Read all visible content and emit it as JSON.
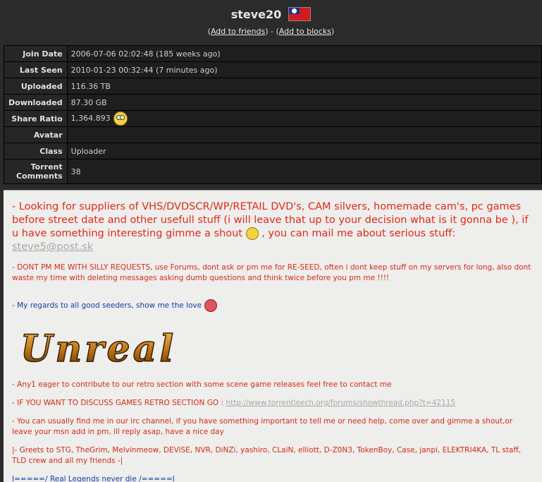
{
  "profile": {
    "username": "steve20",
    "add_friends": "Add to friends",
    "add_blocks": "Add to blocks"
  },
  "info_rows": [
    {
      "label": "Join Date",
      "value": "2006-07-06 02:02:48 (185 weeks ago)"
    },
    {
      "label": "Last Seen",
      "value": "2010-01-23 00:32:44 (7 minutes ago)"
    },
    {
      "label": "Uploaded",
      "value": "116.36 TB"
    },
    {
      "label": "Downloaded",
      "value": "87.30 GB"
    },
    {
      "label": "Share Ratio",
      "value": "1,364.893"
    },
    {
      "label": "Avatar",
      "value": ""
    },
    {
      "label": "Class",
      "value": "Uploader"
    },
    {
      "label": "Torrent Comments",
      "value": "38"
    }
  ],
  "description": {
    "big_text_a": "- Looking for suppliers of VHS/DVDSCR/WP/RETAIL DVD's, CAM silvers, homemade cam's, pc games before street date and other usefull stuff (i will leave that up to your decision what is it gonna be ), if u have something interesting gimme a shout",
    "big_text_b": ", you can mail me about serious stuff:",
    "email": "steve5@post.sk",
    "dont_pm": "- DONT PM ME WITH SILLY REQUESTS, use Forums, dont ask or pm me for RE-SEED, often i dont keep stuff on my servers for long, also dont waste my time with deleting messages asking dumb questions and think twice before you pm me !!!!",
    "regards": "- My regards to all good seeders, show me the love",
    "logo_text": "Unreal",
    "any1": "- Any1 eager to contribute to our retro section with some scene game releases feel free to contact me",
    "discuss": "- IF YOU WANT TO DISCUSS GAMES RETRO SECTION GO :",
    "discuss_url": "http://www.torrentleech.org/forums/showthread.php?t=42115",
    "irc": "- You can usually find me in our irc channel, if you have something important to tell me or need help, come over and gimme a shout,or leave your msn add in pm, ill reply asap, have a nice day",
    "greets": "|- Greets to STG, TheGrim, Melvinmeow, DEViSE, NVR, DiNZi, yashiro, CLaiN, elliott, D-Z0N3, TokenBoy, Case, janpi, ELEKTRI4KA, TL staff, TLD crew and all my friends -|",
    "legends": "I=====/ Real Legends never die /=====I"
  }
}
